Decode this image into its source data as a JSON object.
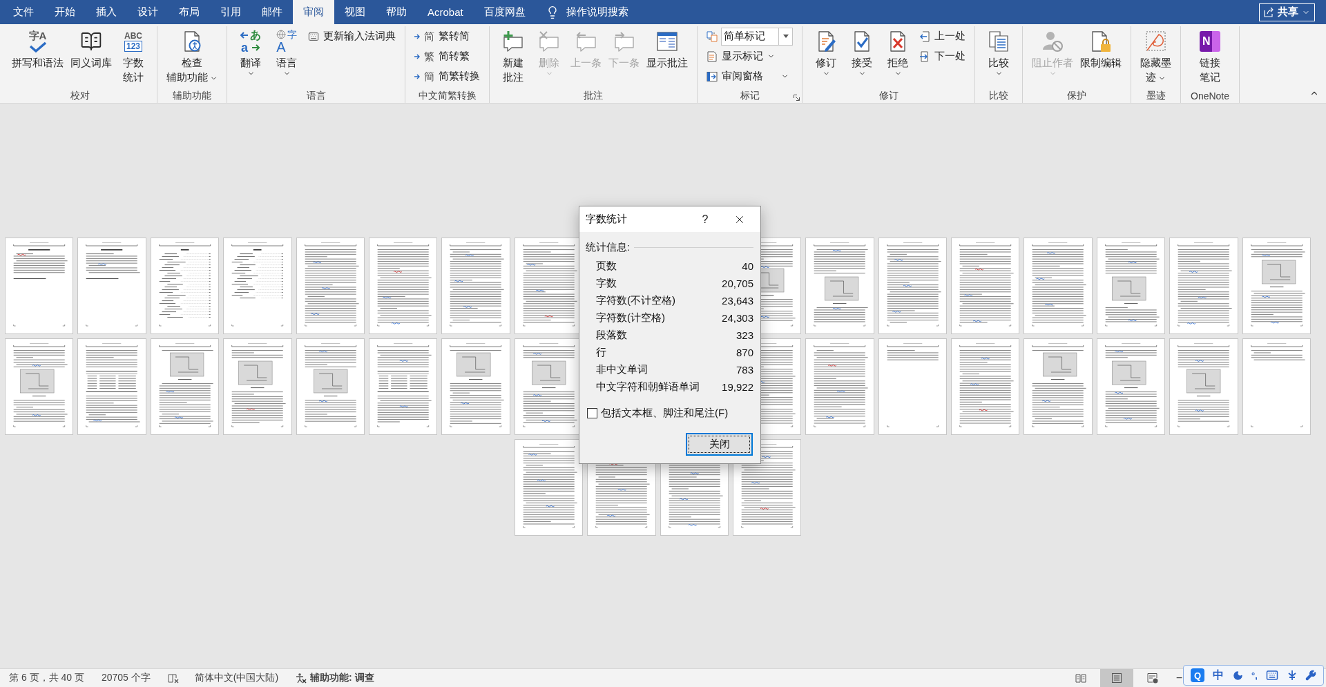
{
  "tabs": [
    {
      "label": "文件",
      "selected": false
    },
    {
      "label": "开始",
      "selected": false
    },
    {
      "label": "插入",
      "selected": false
    },
    {
      "label": "设计",
      "selected": false
    },
    {
      "label": "布局",
      "selected": false
    },
    {
      "label": "引用",
      "selected": false
    },
    {
      "label": "邮件",
      "selected": false
    },
    {
      "label": "审阅",
      "selected": true
    },
    {
      "label": "视图",
      "selected": false
    },
    {
      "label": "帮助",
      "selected": false
    },
    {
      "label": "Acrobat",
      "selected": false
    },
    {
      "label": "百度网盘",
      "selected": false
    }
  ],
  "search": {
    "label": "操作说明搜索"
  },
  "share": {
    "label": "共享"
  },
  "ribbon": {
    "groups": [
      {
        "label": "校对",
        "launcher": false,
        "items": [
          {
            "kind": "large",
            "lines": [
              "拼写和语法"
            ],
            "icon_text": [
              "字A"
            ],
            "menu": false,
            "disabled": false
          },
          {
            "kind": "large",
            "lines": [
              "同义词库"
            ],
            "menu": false,
            "disabled": false
          },
          {
            "kind": "large",
            "lines": [
              "字数",
              "统计"
            ],
            "icon_text": [
              "ABC",
              "123"
            ],
            "menu": false,
            "disabled": false
          }
        ]
      },
      {
        "label": "辅助功能",
        "launcher": false,
        "items": [
          {
            "kind": "large",
            "lines": [
              "检查",
              "辅助功能"
            ],
            "menu": true,
            "disabled": false
          }
        ]
      },
      {
        "label": "语言",
        "launcher": false,
        "items": [
          {
            "kind": "large",
            "lines": [
              "翻译"
            ],
            "icon_text": [
              "あ",
              "a"
            ],
            "menu": true,
            "disabled": false
          },
          {
            "kind": "large",
            "lines": [
              "语言"
            ],
            "icon_text": [
              "字",
              "A"
            ],
            "menu": true,
            "disabled": false
          },
          {
            "kind": "stack",
            "items": [
              {
                "kind": "button",
                "label": "更新输入法词典",
                "menu": false,
                "disabled": false
              }
            ]
          }
        ]
      },
      {
        "label": "中文简繁转换",
        "launcher": false,
        "items": [
          {
            "kind": "stack",
            "items": [
              {
                "kind": "button",
                "label": "繁转简",
                "icon_text": [
                  "简"
                ],
                "menu": false,
                "disabled": false
              },
              {
                "kind": "button",
                "label": "简转繁",
                "icon_text": [
                  "繁"
                ],
                "menu": false,
                "disabled": false
              },
              {
                "kind": "button",
                "label": "简繁转换",
                "icon_text": [
                  "簡"
                ],
                "menu": false,
                "disabled": false
              }
            ]
          }
        ]
      },
      {
        "label": "批注",
        "launcher": false,
        "items": [
          {
            "kind": "large",
            "lines": [
              "新建",
              "批注"
            ],
            "menu": false,
            "disabled": false
          },
          {
            "kind": "large",
            "lines": [
              "删除"
            ],
            "menu": true,
            "disabled": true
          },
          {
            "kind": "large",
            "lines": [
              "上一条"
            ],
            "menu": false,
            "disabled": true
          },
          {
            "kind": "large",
            "lines": [
              "下一条"
            ],
            "menu": false,
            "disabled": true
          },
          {
            "kind": "large",
            "lines": [
              "显示批注"
            ],
            "menu": false,
            "disabled": false
          }
        ]
      },
      {
        "label": "标记",
        "launcher": true,
        "items": [
          {
            "kind": "stack",
            "items": [
              {
                "kind": "select",
                "value": "简单标记"
              },
              {
                "kind": "button",
                "label": "显示标记",
                "menu": true,
                "disabled": false
              },
              {
                "kind": "button",
                "label": "审阅窗格",
                "menu": true,
                "disabled": false
              }
            ]
          }
        ]
      },
      {
        "label": "修订",
        "launcher": false,
        "items": [
          {
            "kind": "large",
            "lines": [
              "修订"
            ],
            "menu": true,
            "disabled": false
          },
          {
            "kind": "large",
            "lines": [
              "接受"
            ],
            "menu": true,
            "disabled": false
          },
          {
            "kind": "large",
            "lines": [
              "拒绝"
            ],
            "menu": true,
            "disabled": false
          },
          {
            "kind": "stack",
            "items": [
              {
                "kind": "button",
                "label": "上一处",
                "menu": false,
                "disabled": false
              },
              {
                "kind": "button",
                "label": "下一处",
                "menu": false,
                "disabled": false
              }
            ]
          }
        ]
      },
      {
        "label": "比较",
        "launcher": false,
        "items": [
          {
            "kind": "large",
            "lines": [
              "比较"
            ],
            "menu": true,
            "disabled": false
          }
        ]
      },
      {
        "label": "保护",
        "launcher": false,
        "items": [
          {
            "kind": "large",
            "lines": [
              "阻止作者"
            ],
            "menu": true,
            "disabled": true
          },
          {
            "kind": "large",
            "lines": [
              "限制编辑"
            ],
            "menu": false,
            "disabled": false
          }
        ]
      },
      {
        "label": "墨迹",
        "launcher": false,
        "items": [
          {
            "kind": "large",
            "lines": [
              "隐藏墨",
              "迹"
            ],
            "menu": true,
            "disabled": false
          }
        ]
      },
      {
        "label": "OneNote",
        "launcher": false,
        "items": [
          {
            "kind": "large",
            "lines": [
              "链接",
              "笔记"
            ],
            "icon_text": [
              "N"
            ],
            "menu": false,
            "disabled": false
          }
        ]
      }
    ]
  },
  "document": {
    "page_rows": [
      {
        "pages": [
          {
            "kind": "abstract"
          },
          {
            "kind": "abstract"
          },
          {
            "kind": "toc"
          },
          {
            "kind": "toc"
          },
          {
            "kind": "text"
          },
          {
            "kind": "text"
          },
          {
            "kind": "text"
          },
          {
            "kind": "text"
          },
          {
            "kind": "covered"
          },
          {
            "kind": "covered"
          },
          {
            "kind": "figure"
          },
          {
            "kind": "figure"
          },
          {
            "kind": "text"
          },
          {
            "kind": "text"
          },
          {
            "kind": "text"
          },
          {
            "kind": "figure"
          },
          {
            "kind": "text"
          },
          {
            "kind": "figure"
          }
        ]
      },
      {
        "pages": [
          {
            "kind": "figure"
          },
          {
            "kind": "table"
          },
          {
            "kind": "figure"
          },
          {
            "kind": "figure"
          },
          {
            "kind": "figure"
          },
          {
            "kind": "table"
          },
          {
            "kind": "figure"
          },
          {
            "kind": "figure"
          },
          {
            "kind": "covered"
          },
          {
            "kind": "covered"
          },
          {
            "kind": "text"
          },
          {
            "kind": "text"
          },
          {
            "kind": "sparse"
          },
          {
            "kind": "text"
          },
          {
            "kind": "figure"
          },
          {
            "kind": "figure"
          },
          {
            "kind": "figure"
          },
          {
            "kind": "sparse"
          }
        ]
      },
      {
        "pages": [
          {
            "kind": "text"
          },
          {
            "kind": "text"
          },
          {
            "kind": "text"
          },
          {
            "kind": "text"
          }
        ]
      }
    ]
  },
  "word_count_dialog": {
    "title": "字数统计",
    "help": "?",
    "section": "统计信息:",
    "stats": [
      {
        "label": "页数",
        "value": "40"
      },
      {
        "label": "字数",
        "value": "20,705"
      },
      {
        "label": "字符数(不计空格)",
        "value": "23,643"
      },
      {
        "label": "字符数(计空格)",
        "value": "24,303"
      },
      {
        "label": "段落数",
        "value": "323"
      },
      {
        "label": "行",
        "value": "870"
      },
      {
        "label": "非中文单词",
        "value": "783"
      },
      {
        "label": "中文字符和朝鲜语单词",
        "value": "19,922"
      }
    ],
    "include_checkbox": {
      "label": "包括文本框、脚注和尾注(F)",
      "checked": false
    },
    "close_button": {
      "label": "关闭",
      "focused": true
    }
  },
  "status_bar": {
    "items": [
      {
        "kind": "text",
        "label": "第 6 页，共 40 页"
      },
      {
        "kind": "text",
        "label": "20705 个字"
      },
      {
        "kind": "proofing"
      },
      {
        "kind": "text",
        "label": "简体中文(中国大陆)"
      },
      {
        "kind": "accessibility",
        "label": "辅助功能: 调查"
      }
    ],
    "views": [
      {
        "kind": "read",
        "selected": false
      },
      {
        "kind": "print",
        "selected": true
      },
      {
        "kind": "web",
        "selected": false
      }
    ],
    "zoom_out": "−"
  },
  "ime_toolbar": {
    "logo": "Q",
    "mode": "中",
    "punctuation": "°,"
  }
}
